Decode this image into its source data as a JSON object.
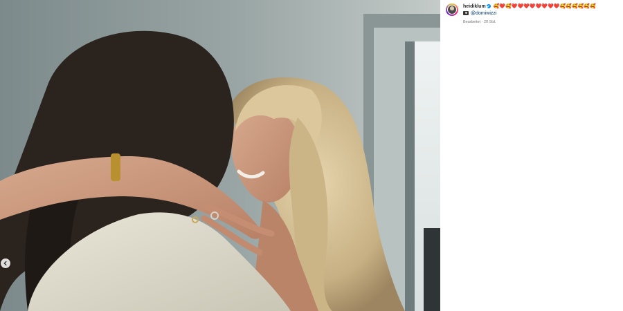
{
  "post": {
    "username": "heidiklum",
    "caption_emojis": "🥰❤️🥰❤️❤️❤️❤️❤️❤️❤️❤️🥰🥰🥰🥰🥰🥰",
    "credit_mention": "@domiwizzi",
    "meta_edited": "Bearbeitet",
    "meta_separator": "·",
    "meta_time": "20 Std."
  },
  "icons": {
    "verified": "verified-badge-icon",
    "camera": "camera-icon",
    "carousel_prev": "chevron-left-icon"
  },
  "colors": {
    "link": "#00376b",
    "verified": "#0095f6",
    "meta_text": "#737373"
  }
}
